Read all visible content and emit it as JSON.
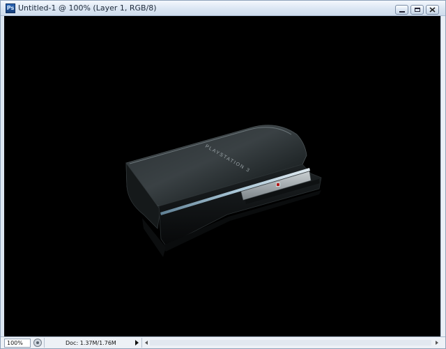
{
  "window": {
    "app_icon_text": "Ps",
    "title": "Untitled-1 @ 100% (Layer 1, RGB/8)"
  },
  "canvas": {
    "background": "#000000",
    "image_brand_text": "PLAYSTATION 3"
  },
  "status": {
    "zoom": "100%",
    "doc_info": "Doc: 1.37M/1.76M"
  },
  "colors": {
    "titlebar": "#dbe6f3",
    "canvas": "#000000",
    "console_body": "#1b1f21",
    "console_accent": "#8fb0c4"
  },
  "icons": {
    "minimize": "minimize-icon",
    "maximize": "maximize-icon",
    "close": "close-icon",
    "status": "status-menu-icon",
    "arrow": "right-arrow-icon"
  }
}
